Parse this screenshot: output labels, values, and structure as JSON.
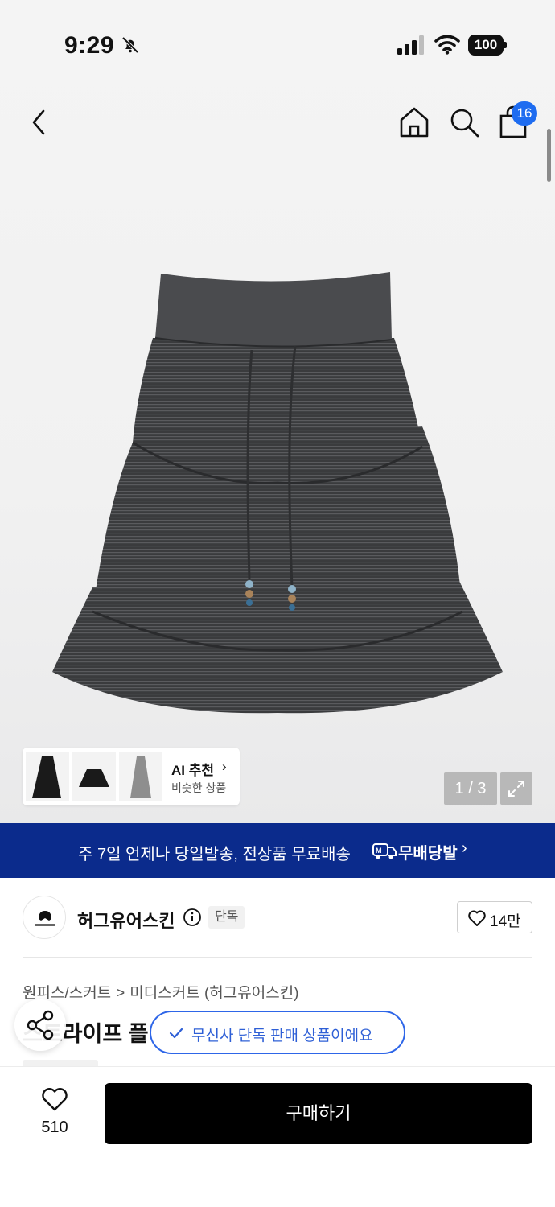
{
  "status_bar": {
    "time": "9:29",
    "battery": "100"
  },
  "nav": {
    "cart_count": "16"
  },
  "gallery": {
    "ai_title": "AI 추천",
    "ai_subtitle": "비슷한 상품",
    "counter": "1 / 3"
  },
  "banner": {
    "text": "주 7일 언제나 당일발송, 전상품 무료배송",
    "brand": "무배당발",
    "chevron": "›"
  },
  "brand": {
    "name": "허그유어스킨",
    "badge": "단독",
    "likes": "14만"
  },
  "breadcrumb": {
    "category": "원피스/스커트",
    "separator": ">",
    "subcategory": "미디스커트 (허그유어스킨)"
  },
  "product": {
    "title_visible": "스트라이프 플"
  },
  "toast": {
    "text": "무신사 단독 판매 상품이에요"
  },
  "bottom_bar": {
    "wish_count": "510",
    "buy_label": "구매하기"
  },
  "colors": {
    "banner_bg": "#0b2b8c",
    "accent_blue": "#1e6cf0",
    "buy_bg": "#000000"
  }
}
